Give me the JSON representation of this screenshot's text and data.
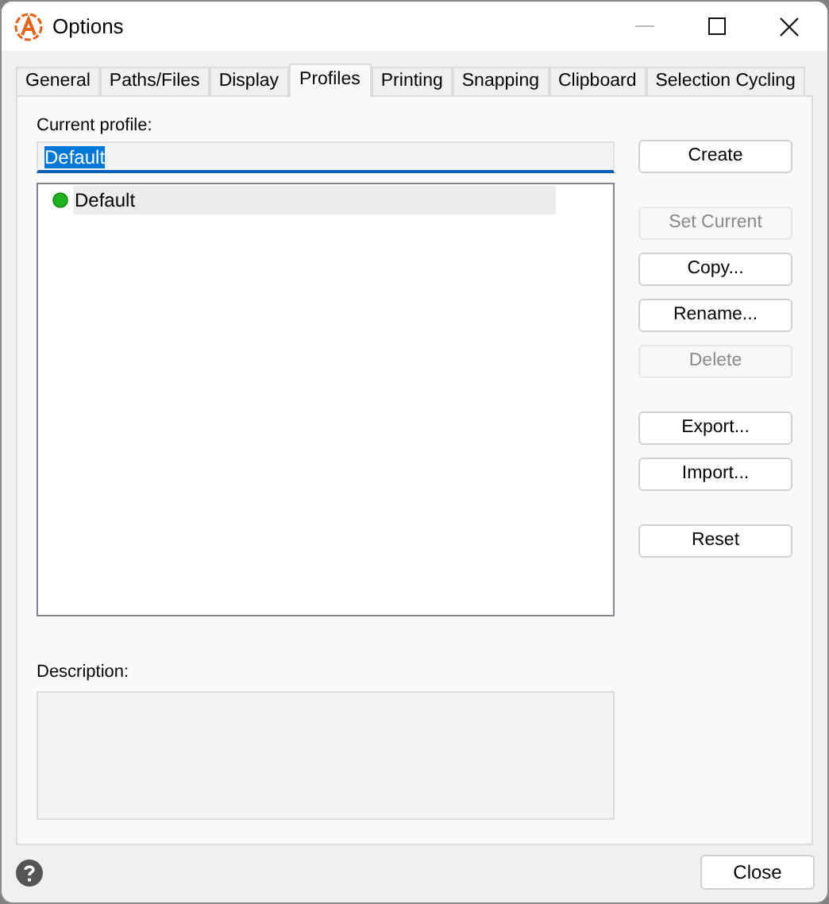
{
  "window": {
    "title": "Options"
  },
  "tabs": [
    {
      "label": "General",
      "selected": false
    },
    {
      "label": "Paths/Files",
      "selected": false
    },
    {
      "label": "Display",
      "selected": false
    },
    {
      "label": "Profiles",
      "selected": true
    },
    {
      "label": "Printing",
      "selected": false
    },
    {
      "label": "Snapping",
      "selected": false
    },
    {
      "label": "Clipboard",
      "selected": false
    },
    {
      "label": "Selection Cycling",
      "selected": false
    }
  ],
  "current_profile": {
    "label": "Current profile:",
    "value": "Default"
  },
  "profiles": [
    {
      "name": "Default",
      "current": true,
      "selected": true
    }
  ],
  "button_groups": [
    [
      {
        "label": "Create",
        "disabled": false
      }
    ],
    [
      {
        "label": "Set Current",
        "disabled": true
      },
      {
        "label": "Copy...",
        "disabled": false
      },
      {
        "label": "Rename...",
        "disabled": false
      },
      {
        "label": "Delete",
        "disabled": true
      }
    ],
    [
      {
        "label": "Export...",
        "disabled": false
      },
      {
        "label": "Import...",
        "disabled": false
      }
    ],
    [
      {
        "label": "Reset",
        "disabled": false
      }
    ]
  ],
  "description": {
    "label": "Description:"
  },
  "footer": {
    "close": "Close"
  }
}
